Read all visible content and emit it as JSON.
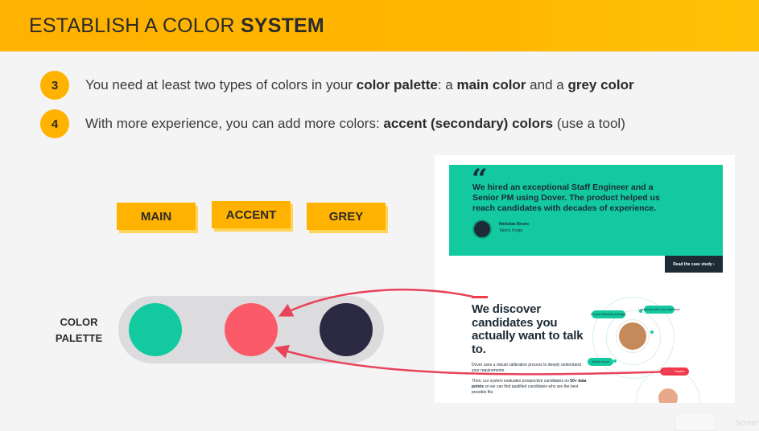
{
  "header": {
    "title_prefix": "ESTABLISH A COLOR ",
    "title_bold": "SYSTEM"
  },
  "points": [
    {
      "num": "3",
      "parts": [
        {
          "text": "You need at least two types of colors in your ",
          "bold": false
        },
        {
          "text": "color palette",
          "bold": true
        },
        {
          "text": ": a ",
          "bold": false
        },
        {
          "text": "main color",
          "bold": true
        },
        {
          "text": " and a ",
          "bold": false
        },
        {
          "text": "grey color",
          "bold": true
        }
      ]
    },
    {
      "num": "4",
      "parts": [
        {
          "text": "With more experience, you can add more colors: ",
          "bold": false
        },
        {
          "text": "accent (secondary) colors",
          "bold": true
        },
        {
          "text": " (use a tool)",
          "bold": false
        }
      ]
    }
  ],
  "tags": {
    "main": "MAIN",
    "accent": "ACCENT",
    "grey": "GREY"
  },
  "palette": {
    "label_line1": "COLOR",
    "label_line2": "PALETTE",
    "colors": {
      "main": "#13c9a0",
      "accent": "#fb5a68",
      "grey": "#2c2a42"
    }
  },
  "example": {
    "quote_mark": "“",
    "testimonial": "We hired an exceptional Staff Engineer and a Senior PM using Dover. The product helped us reach candidates with decades of experience.",
    "person_name": "Nicholas Bruno",
    "person_role": "Talent, Forge",
    "case_study_button": "Read the case study  ›",
    "headline": "We discover candidates you actually want to talk to.",
    "desc1": "Dover uses a robust calibration process to deeply understand your requirements.",
    "desc2_before": "Then, our system evaluates prospective candidates on ",
    "desc2_bold": "50+ data points",
    "desc2_after": " so we can find qualified candidates who are the best possible fits.",
    "chip_product": "Product Marketing Manager",
    "chip_leadership": "Leadership skills & the right track",
    "chip_stretch": "Stretch bonus",
    "chip_upload": "Upload Dropbox",
    "colors": {
      "teal": "#13c9a0",
      "navy": "#1d2b36",
      "red": "#f03a4b"
    }
  },
  "watermark": {
    "text": "Screen"
  }
}
